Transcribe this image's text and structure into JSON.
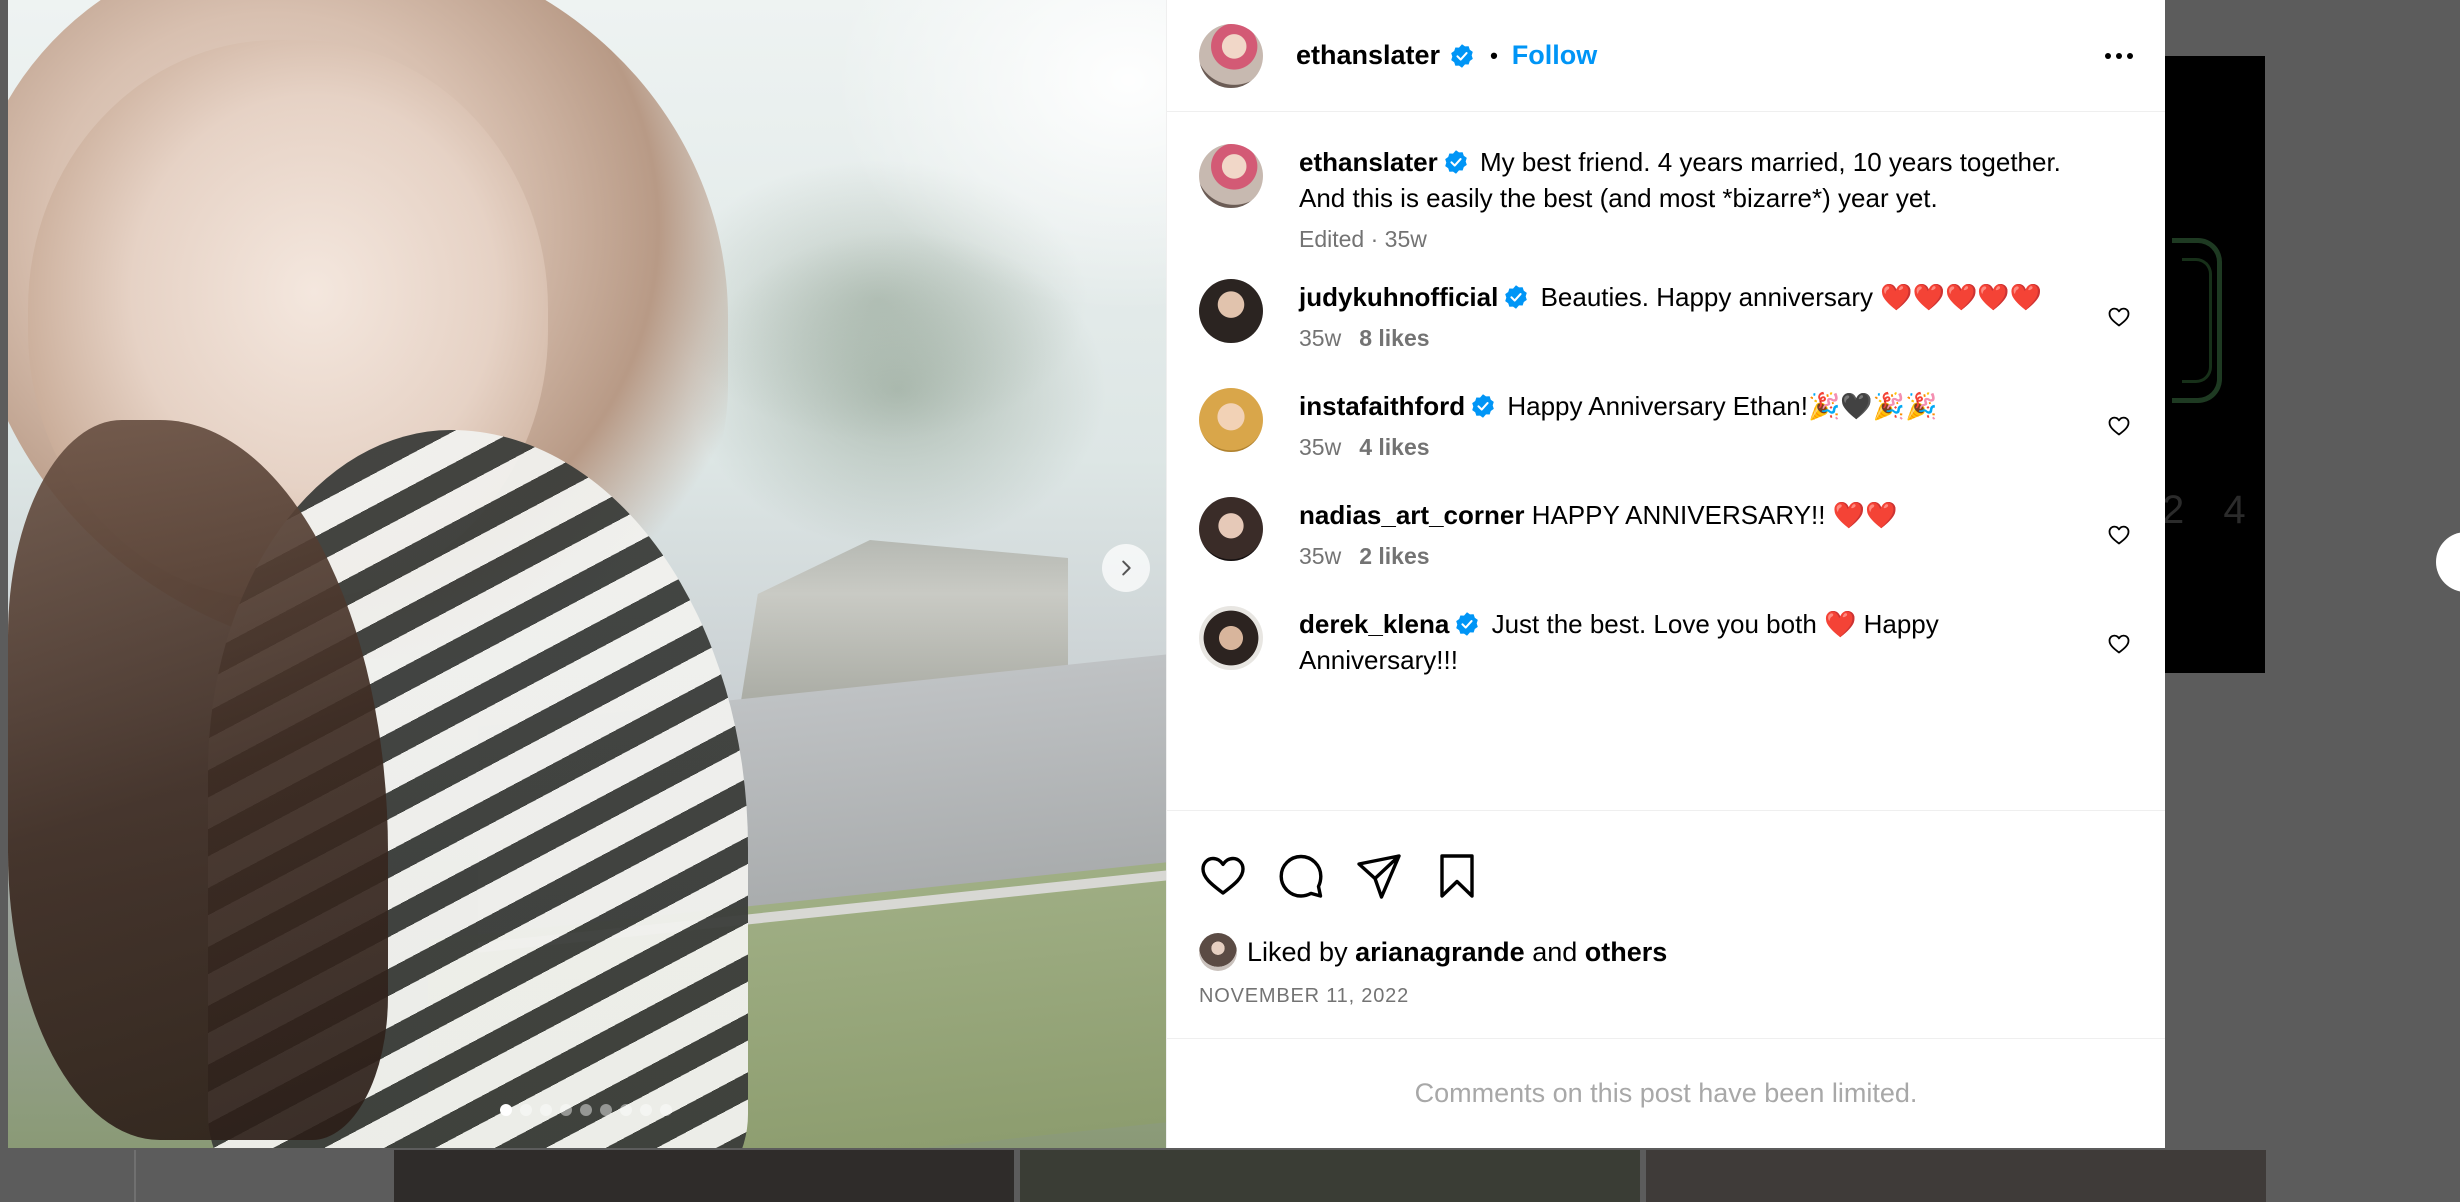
{
  "post": {
    "author": "ethanslater",
    "follow_label": "Follow",
    "separator": "•",
    "caption_text": "My best friend. 4 years married, 10 years together. And this is easily the best (and most *bizarre*) year yet.",
    "caption_meta": "Edited · 35w",
    "photo_count": 9,
    "active_photo_index": 0
  },
  "comments": [
    {
      "user": "judykuhnofficial",
      "verified": true,
      "text": "Beauties. Happy anniversary ❤️❤️❤️❤️❤️",
      "age": "35w",
      "likes": "8 likes"
    },
    {
      "user": "instafaithford",
      "verified": true,
      "text": "Happy Anniversary Ethan!🎉🖤🎉🎉",
      "age": "35w",
      "likes": "4 likes"
    },
    {
      "user": "nadias_art_corner",
      "verified": false,
      "text": "HAPPY ANNIVERSARY!! ❤️❤️",
      "age": "35w",
      "likes": "2 likes"
    },
    {
      "user": "derek_klena",
      "verified": true,
      "text": "Just the best. Love you both ❤️ Happy Anniversary!!!",
      "age": "",
      "likes": ""
    }
  ],
  "likes_summary": {
    "prefix": "Liked by",
    "user": "arianagrande",
    "joiner": "and",
    "others": "others"
  },
  "date": "NOVEMBER 11, 2022",
  "comments_limited": "Comments on this post have been limited.",
  "background": {
    "digits": "2 4"
  },
  "colors": {
    "link_blue": "#0095f6",
    "verified_blue": "#0095f6",
    "muted_text": "#737373",
    "divider": "#efefef",
    "overlay": "#5c5c5c"
  },
  "icons": {
    "more": "more-options-icon",
    "verified": "verified-badge-icon",
    "like": "heart-icon",
    "comment": "comment-icon",
    "share": "share-icon",
    "save": "bookmark-icon",
    "next": "chevron-right-icon"
  }
}
